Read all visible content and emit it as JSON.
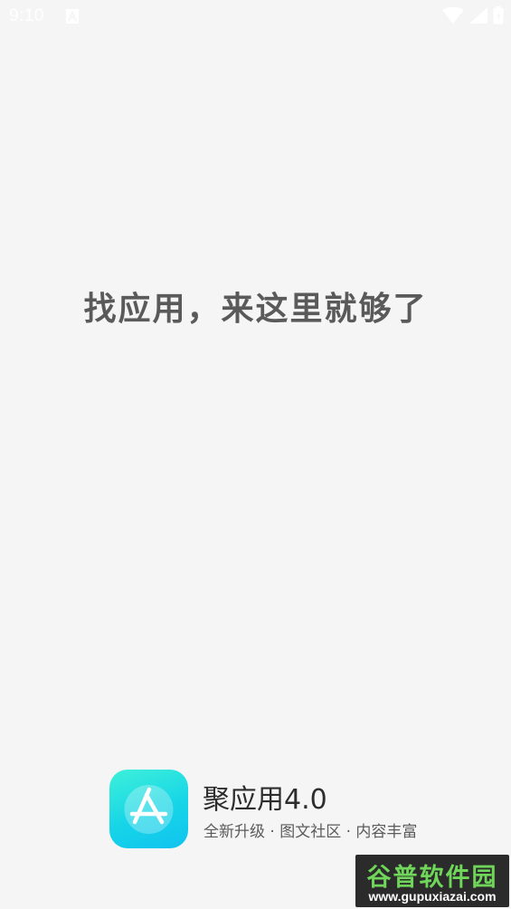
{
  "status_bar": {
    "time": "9:10",
    "notification_icon": "font-a-icon",
    "wifi_icon": "wifi-icon",
    "signal_icon": "cell-signal-icon",
    "battery_icon": "battery-icon"
  },
  "splash": {
    "slogan": "找应用，来这里就够了"
  },
  "brand": {
    "app_icon": "app-store-icon",
    "app_name": "聚应用4.0",
    "tagline": "全新升级 · 图文社区 · 内容丰富"
  },
  "watermark": {
    "title": "谷普软件园",
    "url": "www.gupuxiazai.com"
  },
  "colors": {
    "background": "#f6f5f6",
    "slogan_text": "#5a5a5a",
    "icon_gradient_start": "#3ef0d9",
    "icon_gradient_end": "#0fc3f0",
    "watermark_green": "#6fd65a"
  }
}
